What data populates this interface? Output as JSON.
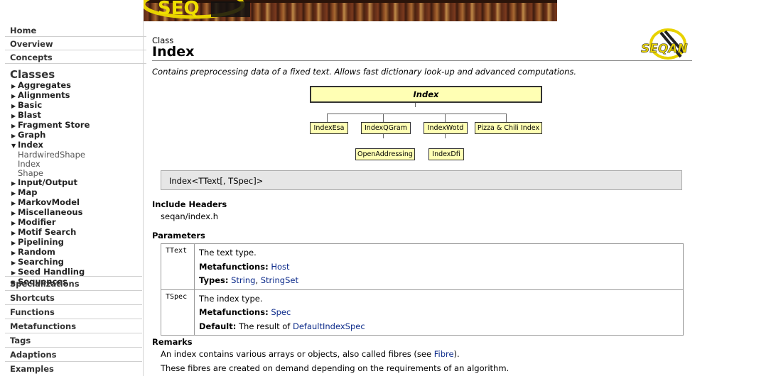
{
  "banner": {
    "logo_text": "SEQ"
  },
  "sidebar": {
    "top_links": [
      "Home",
      "Overview",
      "Concepts"
    ],
    "classes_heading": "Classes",
    "categories": [
      {
        "label": "Aggregates",
        "expanded": false
      },
      {
        "label": "Alignments",
        "expanded": false
      },
      {
        "label": "Basic",
        "expanded": false
      },
      {
        "label": "Blast",
        "expanded": false
      },
      {
        "label": "Fragment Store",
        "expanded": false
      },
      {
        "label": "Graph",
        "expanded": false
      },
      {
        "label": "Index",
        "expanded": true,
        "children": [
          "HardwiredShape",
          "Index",
          "Shape"
        ]
      },
      {
        "label": "Input/Output",
        "expanded": false
      },
      {
        "label": "Map",
        "expanded": false
      },
      {
        "label": "MarkovModel",
        "expanded": false
      },
      {
        "label": "Miscellaneous",
        "expanded": false
      },
      {
        "label": "Modifier",
        "expanded": false
      },
      {
        "label": "Motif Search",
        "expanded": false
      },
      {
        "label": "Pipelining",
        "expanded": false
      },
      {
        "label": "Random",
        "expanded": false
      },
      {
        "label": "Searching",
        "expanded": false
      },
      {
        "label": "Seed Handling",
        "expanded": false
      },
      {
        "label": "Sequences",
        "expanded": false
      }
    ],
    "bottom_links": [
      "Specializations",
      "Shortcuts",
      "Functions",
      "Metafunctions",
      "Tags",
      "Adaptions",
      "Examples"
    ]
  },
  "header": {
    "kind": "Class",
    "title": "Index",
    "logo_text": "SEQAN"
  },
  "summary": "Contains preprocessing data of a fixed text. Allows fast dictionary look-up and advanced computations.",
  "diagram": {
    "root": "Index",
    "children": [
      "IndexEsa",
      "IndexQGram",
      "IndexWotd",
      "Pizza & Chili Index"
    ],
    "grandchildren": [
      "OpenAddressing",
      "IndexDfi"
    ]
  },
  "signature": "Index<TText[, TSpec]>",
  "include": {
    "heading": "Include Headers",
    "path": "seqan/index.h"
  },
  "parameters": {
    "heading": "Parameters",
    "rows": [
      {
        "name": "TText",
        "description": "The text type.",
        "mf_label": "Metafunctions:",
        "mf_value": "Host",
        "extra_label": "Types:",
        "extra_links": [
          "String",
          "StringSet"
        ],
        "extra_sep": ", "
      },
      {
        "name": "TSpec",
        "description": "The index type.",
        "mf_label": "Metafunctions:",
        "mf_value": "Spec",
        "extra_label": "Default:",
        "extra_text": "The result of ",
        "extra_link": "DefaultIndexSpec"
      }
    ]
  },
  "remarks": {
    "heading": "Remarks",
    "line1_pre": "An index contains various arrays or objects, also called fibres (see ",
    "line1_link": "Fibre",
    "line1_post": ").",
    "line2": "These fibres are created on demand depending on the requirements of an algorithm."
  },
  "colors": {
    "box_fill": "#ffffb4",
    "link": "#0b2a8a",
    "signature_bg": "#e6e6e6"
  }
}
